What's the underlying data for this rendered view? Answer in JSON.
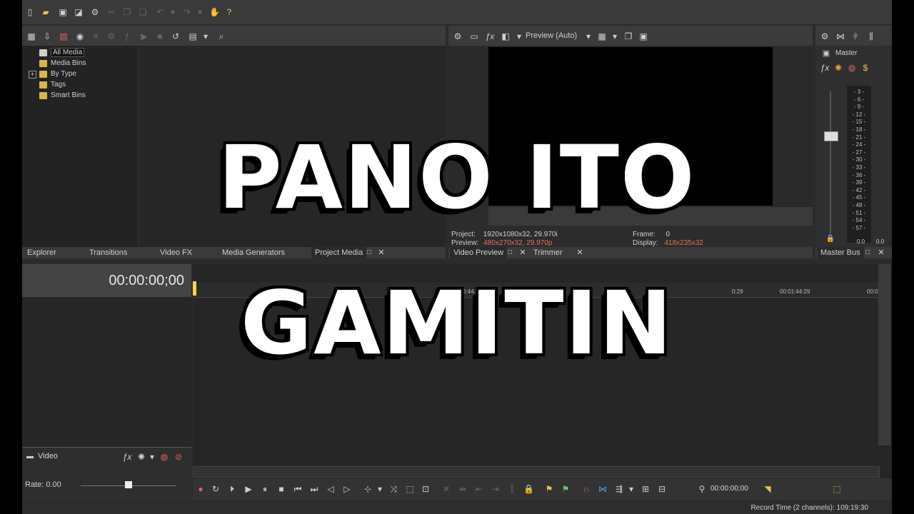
{
  "explorer": {
    "tree": [
      "All Media",
      "Media Bins",
      "By Type",
      "Tags",
      "Smart Bins"
    ],
    "tabs": [
      "Explorer",
      "Transitions",
      "Video FX",
      "Media Generators",
      "Project Media"
    ]
  },
  "preview": {
    "mode_label": "Preview (Auto)",
    "project_label": "Project:",
    "project_value": "1920x1080x32, 29.970i",
    "preview_label": "Preview:",
    "preview_value": "480x270x32, 29.970p",
    "frame_label": "Frame:",
    "frame_value": "0",
    "display_label": "Display:",
    "display_value": "418x235x32",
    "tabs": [
      "Video Preview",
      "Trimmer"
    ]
  },
  "master": {
    "label": "Master",
    "scale": [
      "3",
      "6",
      "9",
      "12",
      "15",
      "18",
      "21",
      "24",
      "27",
      "30",
      "33",
      "36",
      "39",
      "42",
      "45",
      "48",
      "51",
      "54",
      "57"
    ],
    "left_value": "0.0",
    "right_value": "0.0",
    "tab": "Master Bus"
  },
  "timeline": {
    "timecode": "00:00:00;00",
    "ruler": [
      "00:00:1",
      "0:44:29",
      "0:29",
      "00:01:44:29",
      "00:01"
    ],
    "track_name": "Video",
    "rate_label": "Rate: 0.00",
    "transport_timecode": "00:00:00;00"
  },
  "status": {
    "record_time": "Record Time (2 channels):  109:19:30"
  },
  "overlay": {
    "line1": "PANO ITO",
    "line2": "GAMITIN"
  },
  "colors": {
    "accent_orange": "#e0735d",
    "folder_yellow": "#d7b64a"
  }
}
